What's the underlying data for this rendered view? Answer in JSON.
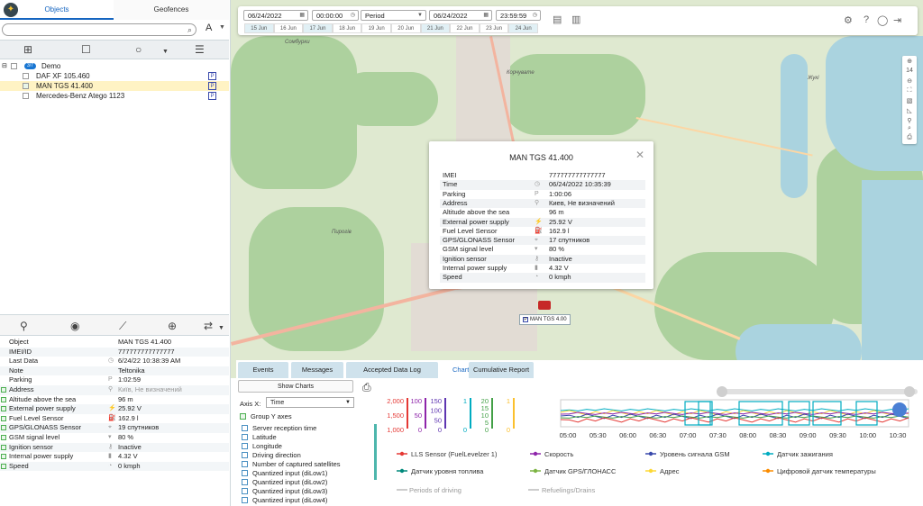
{
  "left": {
    "tabs": {
      "objects": "Objects",
      "geofences": "Geofences"
    },
    "search": {
      "placeholder": "",
      "font_button": "A"
    },
    "tree": {
      "group": {
        "name": "Demo",
        "badge": "3/7"
      },
      "items": [
        {
          "name": "DAF XF 105.460",
          "badge": "P",
          "selected": false
        },
        {
          "name": "MAN TGS 41.400",
          "badge": "P",
          "selected": true
        },
        {
          "name": "Mercedes-Benz Atego 1123",
          "badge": "P",
          "selected": false
        }
      ]
    },
    "info_rows": [
      {
        "label": "Object",
        "icon": "",
        "value": "MAN TGS 41.400",
        "checked": false
      },
      {
        "label": "IMEI/ID",
        "icon": "",
        "value": "777777777777777",
        "checked": false
      },
      {
        "label": "Last Data",
        "icon": "clock-icon",
        "value": "6/24/22 10:38:39 AM",
        "checked": false
      },
      {
        "label": "Note",
        "icon": "",
        "value": "Teltonika",
        "checked": false
      },
      {
        "label": "Parking",
        "icon": "parking-icon",
        "value": "1:02:59",
        "checked": false
      },
      {
        "label": "Address",
        "icon": "pin-icon",
        "value": "Київ, Не визначений",
        "checked": true,
        "muted": true
      },
      {
        "label": "Altitude above the sea",
        "icon": "",
        "value": "96 m",
        "checked": true
      },
      {
        "label": "External power supply",
        "icon": "plug-icon",
        "value": "25.92 V",
        "checked": true
      },
      {
        "label": "Fuel Level Sensor",
        "icon": "fuel-icon",
        "value": "162.9 l",
        "checked": true
      },
      {
        "label": "GPS/GLONASS Sensor",
        "icon": "satellite-icon",
        "value": "19 спутников",
        "checked": true
      },
      {
        "label": "GSM signal level",
        "icon": "signal-icon",
        "value": "80 %",
        "checked": true
      },
      {
        "label": "Ignition sensor",
        "icon": "key-icon",
        "value": "Inactive",
        "checked": true
      },
      {
        "label": "Internal power supply",
        "icon": "battery-icon",
        "value": "4.32 V",
        "checked": true
      },
      {
        "label": "Speed",
        "icon": "speed-icon",
        "value": "0 kmph",
        "checked": true
      }
    ]
  },
  "topbar": {
    "date_from": "06/24/2022",
    "time_from": "00:00:00",
    "period": "Period",
    "date_to": "06/24/2022",
    "time_to": "23:59:59",
    "days": [
      "15 Jun",
      "16 Jun",
      "17 Jun",
      "18 Jun",
      "19 Jun",
      "20 Jun",
      "21 Jun",
      "22 Jun",
      "23 Jun",
      "24 Jun"
    ],
    "highlighted_days": [
      "15 Jun",
      "17 Jun",
      "21 Jun",
      "24 Jun"
    ]
  },
  "map": {
    "zoom": "14",
    "places": [
      "Сомбурки",
      "Корчувате",
      "Пирогів",
      "Жукі"
    ],
    "truck_label": "MAN TGS 4.00"
  },
  "popup": {
    "title": "MAN TGS 41.400",
    "rows": [
      {
        "label": "IMEI",
        "icon": "",
        "value": "777777777777777"
      },
      {
        "label": "Time",
        "icon": "clock-icon",
        "value": "06/24/2022 10:35:39"
      },
      {
        "label": "Parking",
        "icon": "parking-icon",
        "value": "1:00:06"
      },
      {
        "label": "Address",
        "icon": "pin-icon",
        "value": "Киев, Не визначений"
      },
      {
        "label": "Altitude above the sea",
        "icon": "",
        "value": "96 m"
      },
      {
        "label": "External power supply",
        "icon": "plug-icon",
        "value": "25.92 V"
      },
      {
        "label": "Fuel Level Sensor",
        "icon": "fuel-icon",
        "value": "162.9 l"
      },
      {
        "label": "GPS/GLONASS Sensor",
        "icon": "satellite-icon",
        "value": "17 спутников"
      },
      {
        "label": "GSM signal level",
        "icon": "signal-icon",
        "value": "80 %"
      },
      {
        "label": "Ignition sensor",
        "icon": "key-icon",
        "value": "Inactive"
      },
      {
        "label": "Internal power supply",
        "icon": "battery-icon",
        "value": "4.32 V"
      },
      {
        "label": "Speed",
        "icon": "speed-icon",
        "value": "0 kmph"
      }
    ]
  },
  "bottom": {
    "tabs": [
      "Events",
      "Messages",
      "Accepted Data Log",
      "Charts",
      "Cumulative Report"
    ],
    "active_tab": "Charts",
    "show_charts": "Show Charts",
    "axis_x_label": "Axis X:",
    "axis_x_value": "Time",
    "group_y": "Group Y axes",
    "fields": [
      "Server reception time",
      "Latitude",
      "Longitude",
      "Driving direction",
      "Number of captured satellites",
      "Quantized input (diLow1)",
      "Quantized input (diLow2)",
      "Quantized input (diLow3)",
      "Quantized input (diLow4)"
    ]
  },
  "chart_data": {
    "type": "line",
    "x_ticks": [
      "05:00",
      "05:30",
      "06:00",
      "06:30",
      "07:00",
      "07:30",
      "08:00",
      "08:30",
      "09:00",
      "09:30",
      "10:00",
      "10:30"
    ],
    "y_axes": [
      {
        "color": "#e53935",
        "ticks": [
          "2,000",
          "1,500",
          "1,000"
        ]
      },
      {
        "color": "#8e24aa",
        "ticks": [
          "100",
          "50",
          "0"
        ]
      },
      {
        "color": "#5e35b1",
        "ticks": [
          "150",
          "100",
          "50",
          "0"
        ]
      },
      {
        "color": "#00acc1",
        "ticks": [
          "1",
          "0"
        ]
      },
      {
        "color": "#43a047",
        "ticks": [
          "20",
          "15",
          "10",
          "5",
          "0"
        ]
      },
      {
        "color": "#fbc02d",
        "ticks": [
          "1",
          "0"
        ]
      }
    ],
    "series": [
      {
        "name": "LLS Sensor (FuelLevelzer 1)",
        "color": "#e53935"
      },
      {
        "name": "Скорость",
        "color": "#8e24aa"
      },
      {
        "name": "Уровень сигнала GSM",
        "color": "#3949ab"
      },
      {
        "name": "Датчик зажигания",
        "color": "#00acc1"
      },
      {
        "name": "Датчик уровня топлива",
        "color": "#00897b"
      },
      {
        "name": "Датчик GPS/ГЛОНАСС",
        "color": "#7cb342"
      },
      {
        "name": "Адрес",
        "color": "#fdd835"
      },
      {
        "name": "Цифровой датчик температуры",
        "color": "#fb8c00"
      }
    ],
    "legend_extra": [
      "Periods of driving",
      "Refuelings/Drains"
    ]
  }
}
